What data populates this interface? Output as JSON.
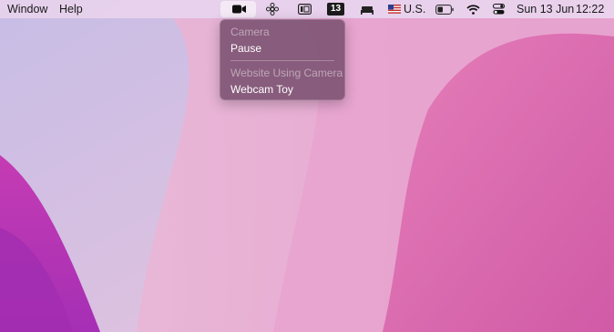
{
  "menubar": {
    "window_label": "Window",
    "help_label": "Help",
    "calendar_badge": "13",
    "keyboard_label": "U.S.",
    "date_label": "Sun 13 Jun",
    "time_label": "12:22",
    "icons": [
      "camera-icon",
      "flower-icon",
      "screen-mirror-icon",
      "calendar-badge",
      "bed-icon",
      "us-flag-icon",
      "battery-icon",
      "wifi-icon",
      "control-center-icon"
    ]
  },
  "camera_menu": {
    "section_camera": "Camera",
    "pause_label": "Pause",
    "section_website": "Website Using Camera",
    "site_label": "Webcam Toy"
  }
}
